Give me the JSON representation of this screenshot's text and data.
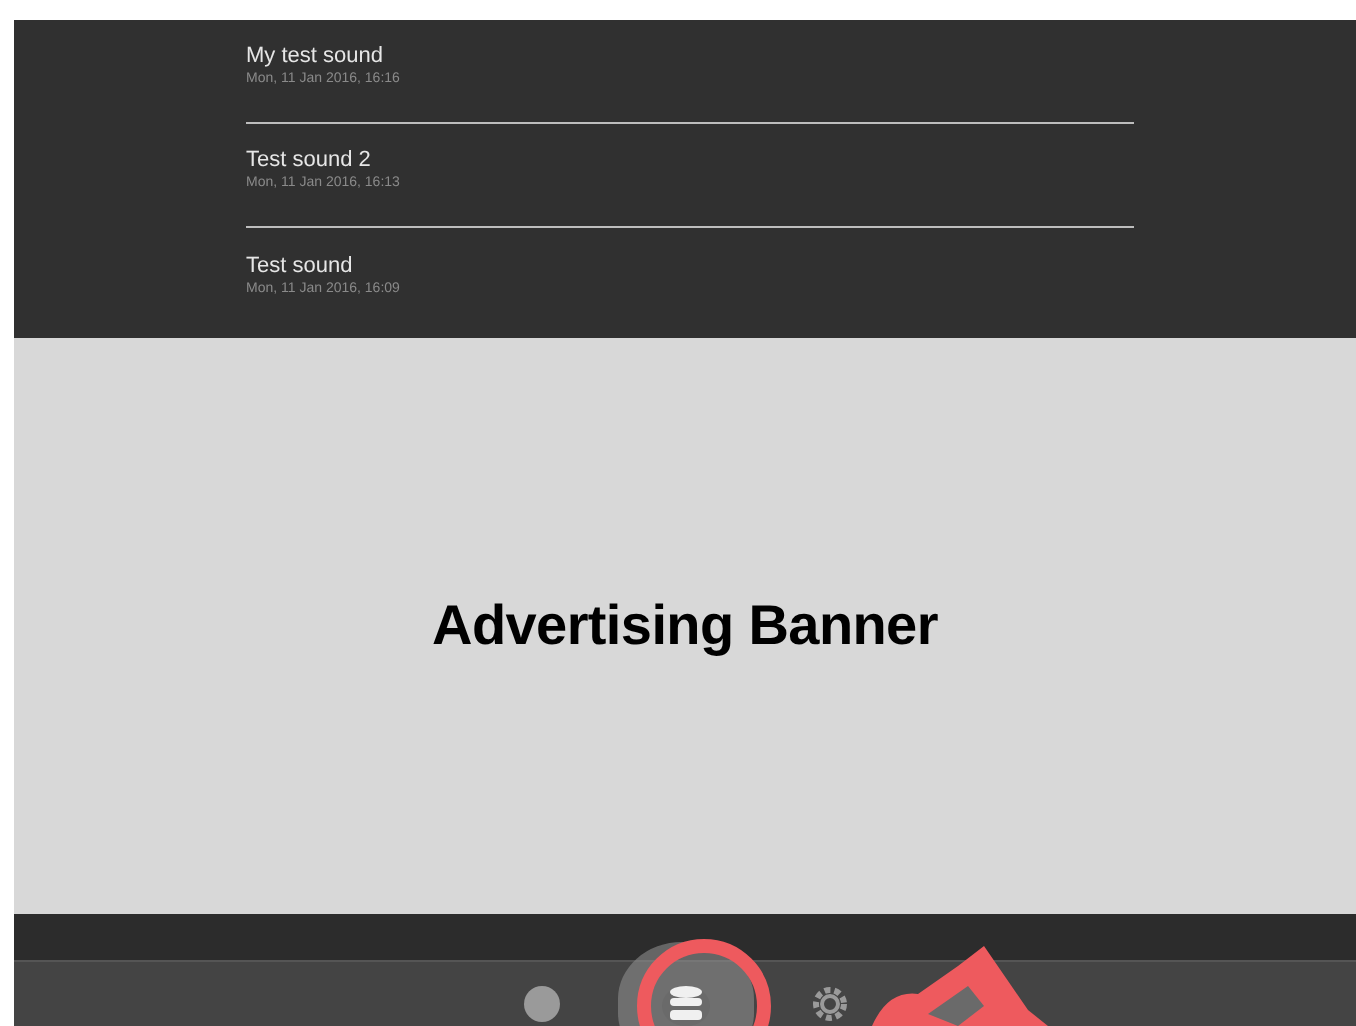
{
  "recordings": [
    {
      "title": "My test sound",
      "date": "Mon, 11 Jan 2016, 16:16"
    },
    {
      "title": "Test sound 2",
      "date": "Mon, 11 Jan 2016, 16:13"
    },
    {
      "title": "Test sound",
      "date": "Mon, 11 Jan 2016, 16:09"
    }
  ],
  "banner": {
    "label": "Advertising Banner"
  },
  "tab_bar": {
    "tabs": [
      {
        "kind": "record",
        "selected": false
      },
      {
        "kind": "media",
        "selected": true
      },
      {
        "kind": "settings",
        "selected": false
      }
    ]
  }
}
